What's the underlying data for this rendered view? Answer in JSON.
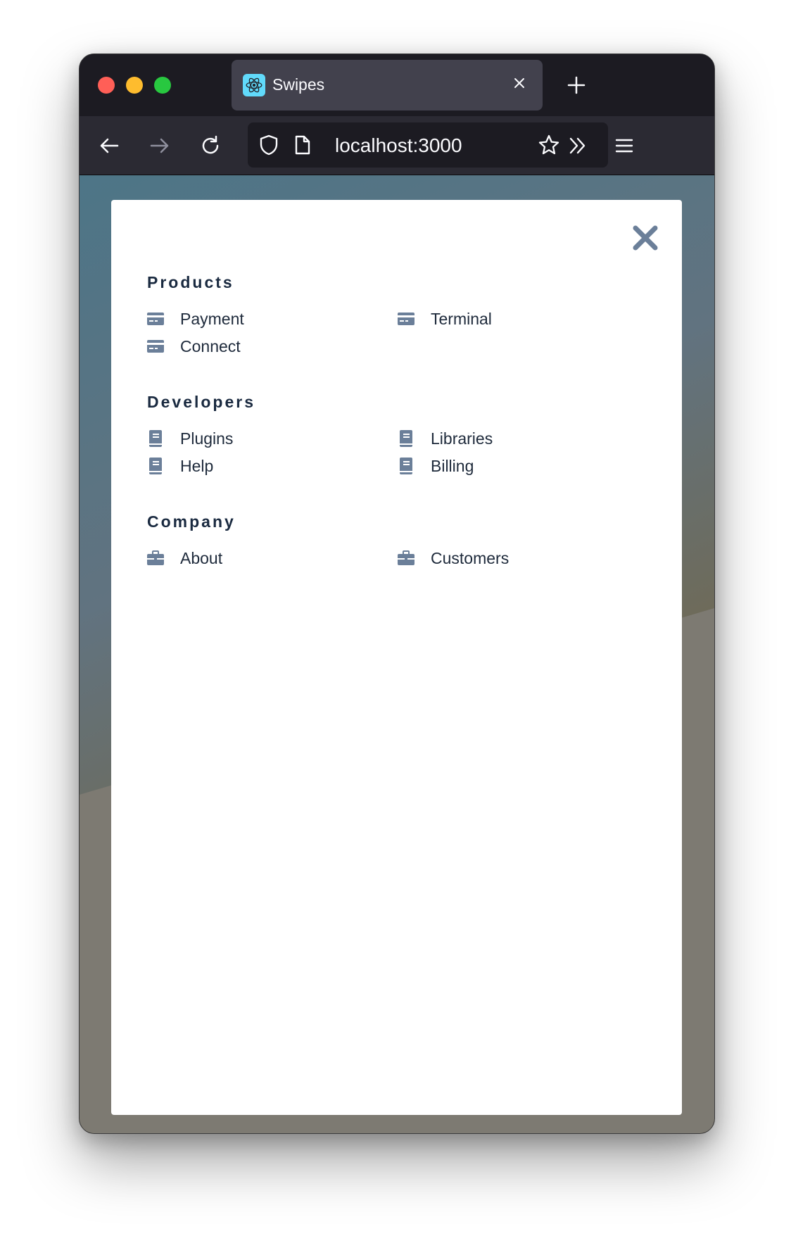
{
  "browser": {
    "tab_title": "Swipes",
    "url": "localhost:3000"
  },
  "menu": {
    "sections": [
      {
        "title": "Products",
        "items": [
          {
            "label": "Payment",
            "icon": "credit-card-icon"
          },
          {
            "label": "Terminal",
            "icon": "credit-card-icon"
          },
          {
            "label": "Connect",
            "icon": "credit-card-icon"
          }
        ]
      },
      {
        "title": "Developers",
        "items": [
          {
            "label": "Plugins",
            "icon": "book-icon"
          },
          {
            "label": "Libraries",
            "icon": "book-icon"
          },
          {
            "label": "Help",
            "icon": "book-icon"
          },
          {
            "label": "Billing",
            "icon": "book-icon"
          }
        ]
      },
      {
        "title": "Company",
        "items": [
          {
            "label": "About",
            "icon": "briefcase-icon"
          },
          {
            "label": "Customers",
            "icon": "briefcase-icon"
          }
        ]
      }
    ]
  },
  "colors": {
    "icon": "#6b7f99",
    "heading": "#1a2a40",
    "text": "#1e2a3b",
    "chrome_dark": "#1c1b22",
    "chrome_bar": "#2b2a33"
  }
}
